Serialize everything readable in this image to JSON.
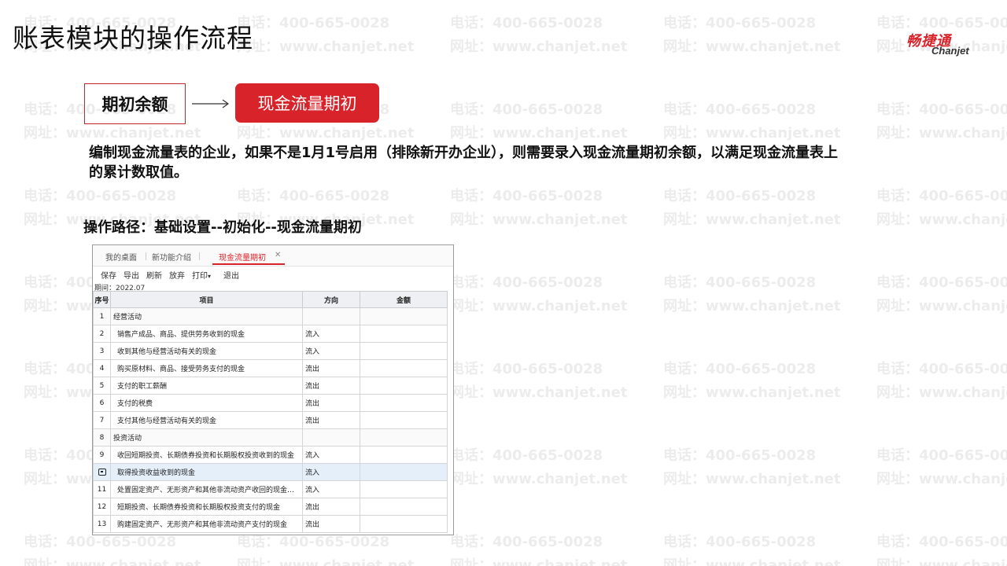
{
  "slide": {
    "title": "账表模块的操作流程",
    "logo_cn": "畅捷通",
    "logo_en": "Chanjet",
    "watermark_line1": "电话：400-665-0028",
    "watermark_line2": "网址：www.chanjet.net",
    "flow": {
      "step1": "期初余额",
      "step2": "现金流量期初"
    },
    "description": "编制现金流量表的企业，如果不是1月1号启用（排除新开办企业），则需要录入现金流量期初余额，以满足现金流量表上的累计数取值。",
    "path": "操作路径：基础设置--初始化--现金流量期初"
  },
  "app": {
    "tabs": [
      {
        "label": "我的桌面"
      },
      {
        "label": "新功能介绍"
      },
      {
        "label": "现金流量期初",
        "active": true
      }
    ],
    "toolbar": {
      "save": "保存",
      "export": "导出",
      "refresh": "刷新",
      "discard": "放弃",
      "print": "打印",
      "exit": "退出"
    },
    "period": "期间：2022.07",
    "columns": {
      "no": "序号",
      "item": "项目",
      "direction": "方向",
      "amount": "金额"
    },
    "rows": [
      {
        "no": "1",
        "item": "经营活动",
        "direction": "",
        "amount": "",
        "type": "group"
      },
      {
        "no": "2",
        "item": "销售产成品、商品、提供劳务收到的现金",
        "direction": "流入",
        "amount": ""
      },
      {
        "no": "3",
        "item": "收到其他与经营活动有关的现金",
        "direction": "流入",
        "amount": ""
      },
      {
        "no": "4",
        "item": "购买原材料、商品、接受劳务支付的现金",
        "direction": "流出",
        "amount": ""
      },
      {
        "no": "5",
        "item": "支付的职工薪酬",
        "direction": "流出",
        "amount": ""
      },
      {
        "no": "6",
        "item": "支付的税费",
        "direction": "流出",
        "amount": ""
      },
      {
        "no": "7",
        "item": "支付其他与经营活动有关的现金",
        "direction": "流出",
        "amount": ""
      },
      {
        "no": "8",
        "item": "投资活动",
        "direction": "",
        "amount": "",
        "type": "group"
      },
      {
        "no": "9",
        "item": "收回短期投资、长期债券投资和长期股权投资收到的现金",
        "direction": "流入",
        "amount": ""
      },
      {
        "no": "",
        "item": "取得投资收益收到的现金",
        "direction": "流入",
        "amount": "",
        "selected": true
      },
      {
        "no": "11",
        "item": "处置固定资产、无形资产和其他非流动资产收回的现金净额",
        "direction": "流入",
        "amount": ""
      },
      {
        "no": "12",
        "item": "短期投资、长期债券投资和长期股权投资支付的现金",
        "direction": "流出",
        "amount": ""
      },
      {
        "no": "13",
        "item": "购建固定资产、无形资产和其他非流动资产支付的现金",
        "direction": "流出",
        "amount": ""
      }
    ]
  }
}
